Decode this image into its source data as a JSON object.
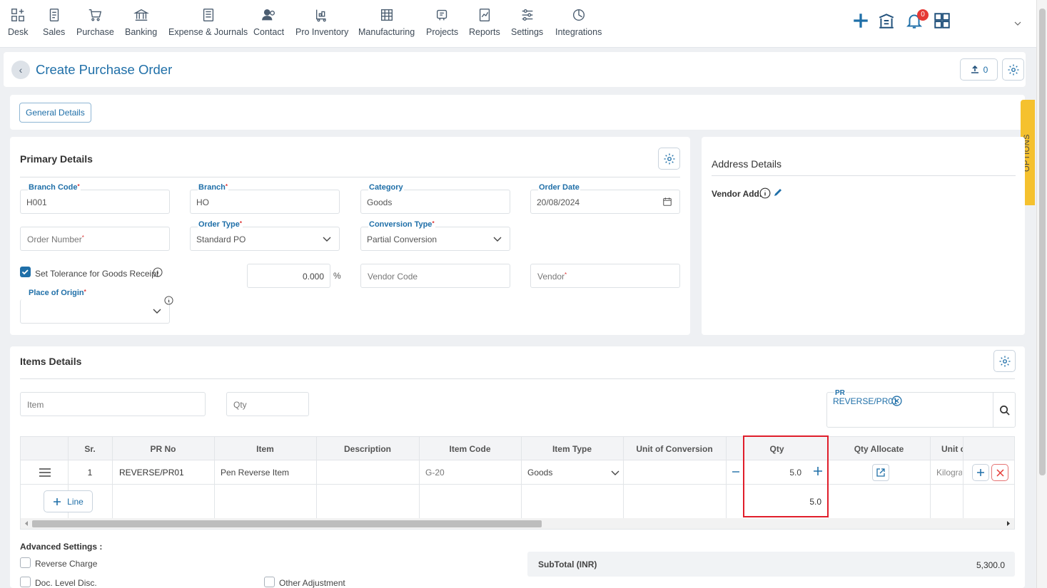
{
  "nav": {
    "items": [
      {
        "label": "Desk",
        "icon": "desk-icon"
      },
      {
        "label": "Sales",
        "icon": "sales-icon"
      },
      {
        "label": "Purchase",
        "icon": "cart-icon"
      },
      {
        "label": "Banking",
        "icon": "bank-icon"
      },
      {
        "label": "Expense & Journals",
        "icon": "journal-icon"
      },
      {
        "label": "Contact",
        "icon": "contact-icon"
      },
      {
        "label": "Pro Inventory",
        "icon": "inventory-icon"
      },
      {
        "label": "Manufacturing",
        "icon": "manufacturing-icon"
      },
      {
        "label": "Projects",
        "icon": "projects-icon"
      },
      {
        "label": "Reports",
        "icon": "reports-icon"
      },
      {
        "label": "Settings",
        "icon": "settings-sliders-icon"
      },
      {
        "label": "Integrations",
        "icon": "integrations-icon"
      }
    ],
    "notification_count": "0",
    "accent": "#1f6fa8"
  },
  "header": {
    "title": "Create Purchase Order",
    "upload_count": "0"
  },
  "tabs": {
    "general_details": "General Details"
  },
  "options_tab": "OPTIONS",
  "primary": {
    "title": "Primary Details",
    "branch_code": {
      "label": "Branch Code",
      "value": "H001"
    },
    "branch": {
      "label": "Branch",
      "value": "HO"
    },
    "category": {
      "label": "Category",
      "value": "Goods"
    },
    "order_date": {
      "label": "Order Date",
      "value": "20/08/2024"
    },
    "order_number": {
      "placeholder": "Order Number"
    },
    "order_type": {
      "label": "Order Type",
      "value": "Standard PO"
    },
    "conversion_type": {
      "label": "Conversion Type",
      "value": "Partial Conversion"
    },
    "tolerance": {
      "label": "Set Tolerance for Goods Receipt",
      "checked": true,
      "value": "0.000",
      "unit": "%"
    },
    "vendor_code": {
      "placeholder": "Vendor Code"
    },
    "vendor": {
      "placeholder": "Vendor"
    },
    "place_of_origin": {
      "label": "Place of Origin"
    }
  },
  "address": {
    "title": "Address Details",
    "vendor_add": "Vendor Add."
  },
  "items": {
    "title": "Items Details",
    "item_placeholder": "Item",
    "qty_placeholder": "Qty",
    "pr_label": "PR",
    "pr_chip": "REVERSE/PR01",
    "columns": [
      "Sr.",
      "PR No",
      "Item",
      "Description",
      "Item Code",
      "Item Type",
      "Unit of Conversion",
      "Qty",
      "Qty Allocate",
      "Unit c"
    ],
    "rows": [
      {
        "sr": "1",
        "pr_no": "REVERSE/PR01",
        "item": "Pen Reverse Item",
        "description": "",
        "item_code": "G-20",
        "item_type": "Goods",
        "unit_conversion": "",
        "qty": "5.0",
        "unit": "Kilogra"
      }
    ],
    "add_line": "Line",
    "qty_total": "5.0"
  },
  "advanced": {
    "title": "Advanced Settings :",
    "reverse_charge": "Reverse Charge",
    "doc_level_disc": "Doc. Level Disc.",
    "other_adjustment": "Other Adjustment",
    "subtotal_label": "SubTotal (INR)",
    "subtotal_value": "5,300.0"
  }
}
